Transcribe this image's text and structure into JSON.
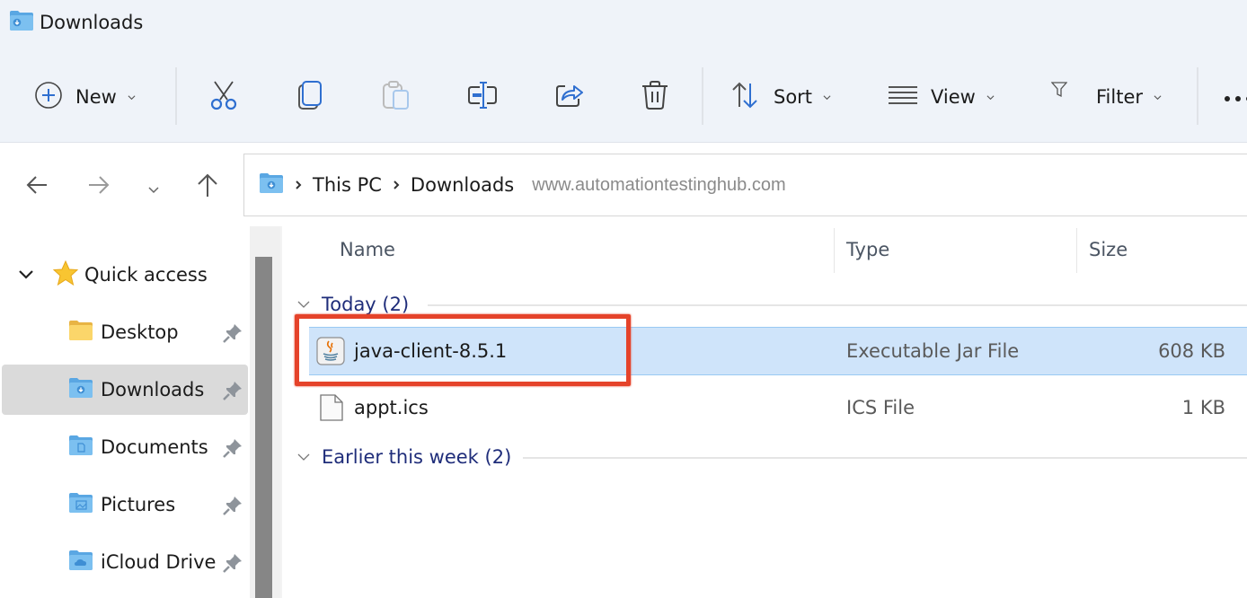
{
  "window": {
    "title": "Downloads",
    "title_icon": "downloads-folder-icon"
  },
  "ribbon": {
    "new_label": "New",
    "cut_icon": "scissors-icon",
    "copy_icon": "copy-icon",
    "paste_icon": "paste-icon",
    "rename_icon": "rename-icon",
    "share_icon": "share-icon",
    "delete_icon": "trash-icon",
    "sort_label": "Sort",
    "view_label": "View",
    "filter_label": "Filter",
    "more_icon": "ellipsis-icon",
    "accent": "#2f6fd0"
  },
  "nav": {
    "back_icon": "arrow-left-icon",
    "forward_icon": "arrow-right-icon",
    "recent_icon": "chevron-down-icon",
    "up_icon": "arrow-up-icon",
    "breadcrumb": [
      "This PC",
      "Downloads"
    ],
    "watermark": "www.automationtestinghub.com"
  },
  "sidebar": {
    "quick_access_label": "Quick access",
    "items": [
      {
        "label": "Desktop",
        "icon": "desktop-folder-icon",
        "pinned": true,
        "selected": false
      },
      {
        "label": "Downloads",
        "icon": "downloads-folder-icon",
        "pinned": true,
        "selected": true
      },
      {
        "label": "Documents",
        "icon": "documents-folder-icon",
        "pinned": true,
        "selected": false
      },
      {
        "label": "Pictures",
        "icon": "pictures-folder-icon",
        "pinned": true,
        "selected": false
      },
      {
        "label": "iCloud Drive",
        "icon": "icloud-folder-icon",
        "pinned": true,
        "selected": false
      }
    ]
  },
  "list": {
    "columns": [
      "Name",
      "Type",
      "Size"
    ],
    "groups": [
      {
        "label": "Today (2)",
        "files": [
          {
            "name": "java-client-8.5.1",
            "type": "Executable Jar File",
            "size": "608 KB",
            "icon": "java-jar-icon",
            "selected": true
          },
          {
            "name": "appt.ics",
            "type": "ICS File",
            "size": "1 KB",
            "icon": "generic-file-icon",
            "selected": false
          }
        ]
      },
      {
        "label": "Earlier this week (2)",
        "files": []
      }
    ],
    "selection_color": "#cfe4fa",
    "annotation_color": "#e5432a"
  }
}
